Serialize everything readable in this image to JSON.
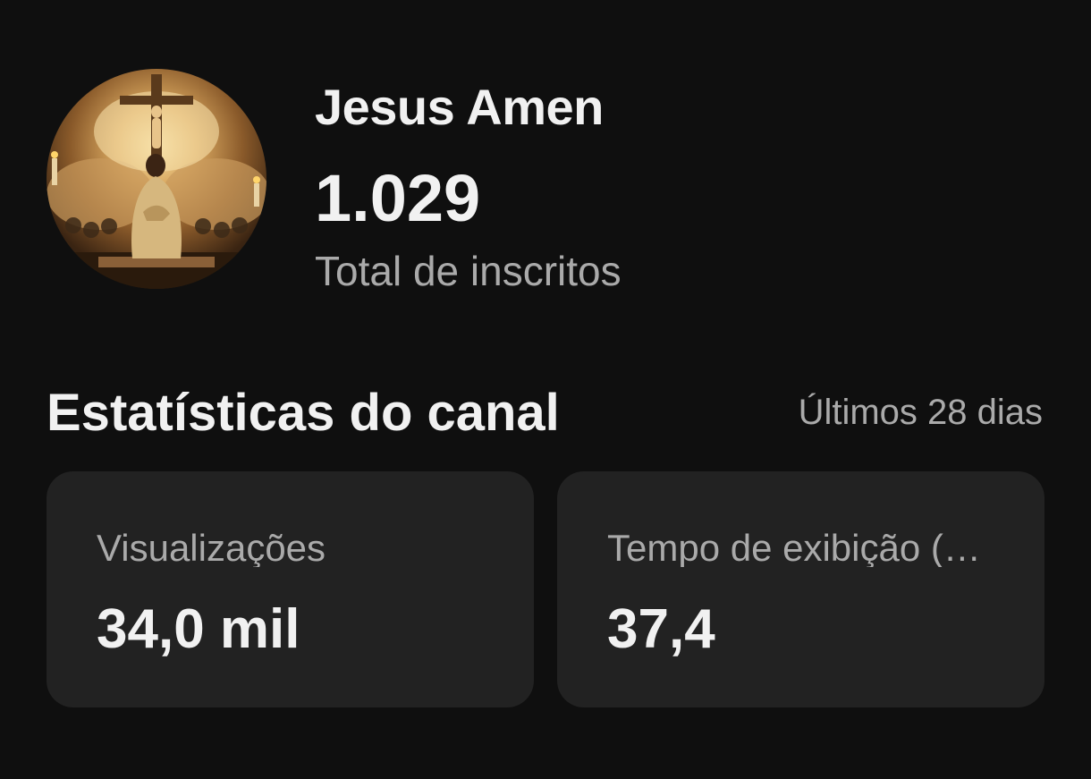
{
  "channel": {
    "name": "Jesus Amen",
    "subscriber_count": "1.029",
    "subscriber_label": "Total de inscritos"
  },
  "stats": {
    "title": "Estatísticas do canal",
    "period": "Últimos 28 dias",
    "cards": [
      {
        "label": "Visualizações",
        "value": "34,0 mil"
      },
      {
        "label": "Tempo de exibição (…",
        "value": "37,4"
      }
    ]
  },
  "colors": {
    "background": "#0f0f0f",
    "card": "#222222",
    "primary_text": "#f1f1f1",
    "secondary_text": "#aaaaaa"
  }
}
